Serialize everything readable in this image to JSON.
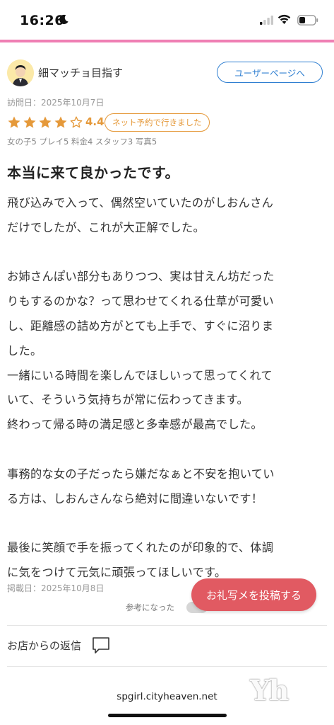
{
  "status_bar": {
    "time": "16:26",
    "icons": [
      "moon-icon",
      "signal-icon",
      "wifi-icon",
      "battery-icon"
    ]
  },
  "accent_colors": {
    "top_line": "#ef7fb3",
    "link_blue": "#2f7fd1",
    "star_orange": "#e5993a",
    "cta_red": "#e15a62"
  },
  "review": {
    "username": "細マッチョ目指す",
    "user_page_button": "ユーザーページへ",
    "visit_date": "訪問日：2025年10月7日",
    "rating": {
      "value": "4.4",
      "stars_filled": 4,
      "stars_total": 5
    },
    "badge": "ネット予約で行きました",
    "sub_ratings": "女の子5 プレイ5 料金4 スタッフ3 写真5",
    "title": "本当に来て良かったです。",
    "body_lines": [
      "飛び込みで入って、偶然空いていたのがしおんさん",
      "だけでしたが、これが大正解でした。",
      "",
      "お姉さんぽい部分もありつつ、実は甘えん坊だった",
      "りもするのかな？って思わせてくれる仕草が可愛い",
      "し、距離感の詰め方がとても上手で、すぐに沼りま",
      "した。",
      "一緒にいる時間を楽しんでほしいって思ってくれて",
      "いて、そういう気持ちが常に伝わってきます。",
      "終わって帰る時の満足感と多幸感が最高でした。",
      "",
      "事務的な女の子だったら嫌だなぁと不安を抱いてい",
      "る方は、しおんさんなら絶対に間違いないです！",
      "",
      "最後に笑顔で手を振ってくれたのが印象的で、体調",
      "に気をつけて元気に頑張ってほしいです。"
    ],
    "posted_date": "掲載日：2025年10月8日",
    "helpful_label": "参考になった",
    "shop_reply_label": "お店からの返信"
  },
  "floating_button": {
    "label": "お礼写メを投稿する"
  },
  "browser": {
    "url": "spgirl.cityheaven.net"
  },
  "watermark": "Yh"
}
